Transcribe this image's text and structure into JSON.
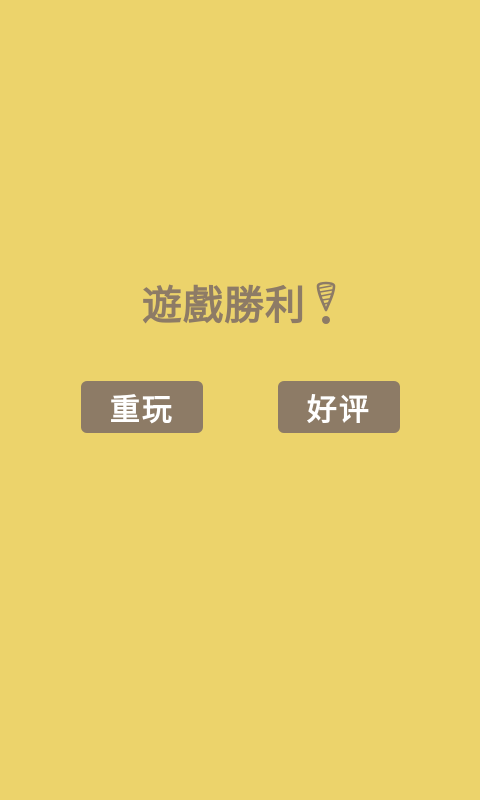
{
  "colors": {
    "background": "#ECD36B",
    "text": "#8D7B66",
    "button_bg": "#8D7B66",
    "button_text": "#FFFFFF"
  },
  "title": {
    "text": "遊戲勝利",
    "icon": "exclamation-mark-icon"
  },
  "buttons": {
    "replay_label": "重玩",
    "rate_label": "好评"
  }
}
